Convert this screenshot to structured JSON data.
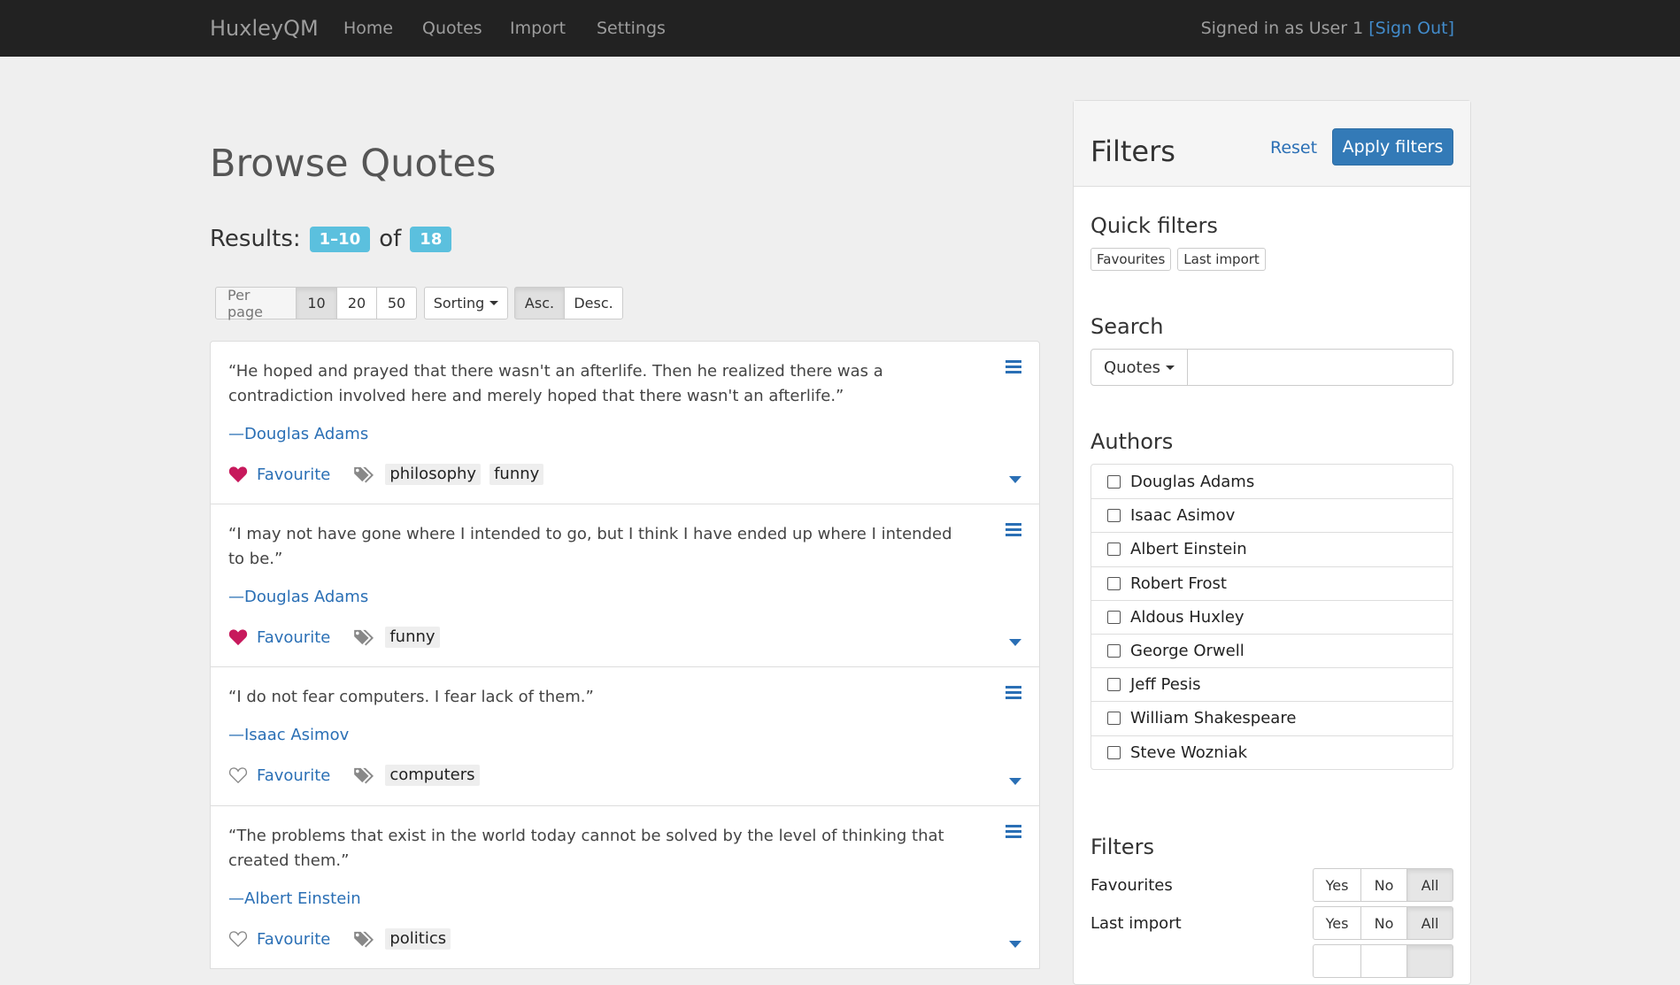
{
  "navbar": {
    "brand": "HuxleyQM",
    "links": [
      "Home",
      "Quotes",
      "Import",
      "Settings"
    ],
    "signed_in": "Signed in as User 1",
    "sign_out": "[Sign Out]"
  },
  "main": {
    "title": "Browse Quotes",
    "results_label": "Results:",
    "results_range": "1–10",
    "results_of": "of",
    "results_total": "18",
    "toolbar": {
      "per_page_label": "Per page",
      "per_page_options": [
        "10",
        "20",
        "50"
      ],
      "per_page_selected": "10",
      "sorting_label": "Sorting",
      "order_options": [
        "Asc.",
        "Desc."
      ],
      "order_selected": "Asc."
    },
    "quotes": [
      {
        "text": "“He hoped and prayed that there wasn't an afterlife. Then he realized there was a contradiction involved here and merely hoped that there wasn't an afterlife.”",
        "author": "—Douglas Adams",
        "favourite": true,
        "favourite_label": "Favourite",
        "tags": [
          "philosophy",
          "funny"
        ]
      },
      {
        "text": "“I may not have gone where I intended to go, but I think I have ended up where I intended to be.”",
        "author": "—Douglas Adams",
        "favourite": true,
        "favourite_label": "Favourite",
        "tags": [
          "funny"
        ]
      },
      {
        "text": "“I do not fear computers. I fear lack of them.”",
        "author": "—Isaac Asimov",
        "favourite": false,
        "favourite_label": "Favourite",
        "tags": [
          "computers"
        ]
      },
      {
        "text": "“The problems that exist in the world today cannot be solved by the level of thinking that created them.”",
        "author": "—Albert Einstein",
        "favourite": false,
        "favourite_label": "Favourite",
        "tags": [
          "politics"
        ]
      }
    ]
  },
  "sidebar": {
    "title": "Filters",
    "reset": "Reset",
    "apply": "Apply filters",
    "quick_filters_title": "Quick filters",
    "quick_filters": [
      "Favourites",
      "Last import"
    ],
    "search_title": "Search",
    "search_scope": "Quotes",
    "search_value": "",
    "authors_title": "Authors",
    "authors": [
      "Douglas Adams",
      "Isaac Asimov",
      "Albert Einstein",
      "Robert Frost",
      "Aldous Huxley",
      "George Orwell",
      "Jeff Pesis",
      "William Shakespeare",
      "Steve Wozniak"
    ],
    "filters_title": "Filters",
    "filters": [
      {
        "label": "Favourites",
        "options": [
          "Yes",
          "No",
          "All"
        ],
        "selected": "All"
      },
      {
        "label": "Last import",
        "options": [
          "Yes",
          "No",
          "All"
        ],
        "selected": "All"
      }
    ]
  },
  "colors": {
    "navbar": "#222222",
    "link": "#2a6fb5",
    "badge": "#5bc0de",
    "heart": "#c7195c",
    "primary": "#337ab7"
  },
  "icons": {
    "heart_filled": "heart-icon",
    "heart_outline": "heart-outline-icon",
    "tags": "tags-icon",
    "menu": "menu-icon",
    "expand": "chevron-down-icon"
  }
}
